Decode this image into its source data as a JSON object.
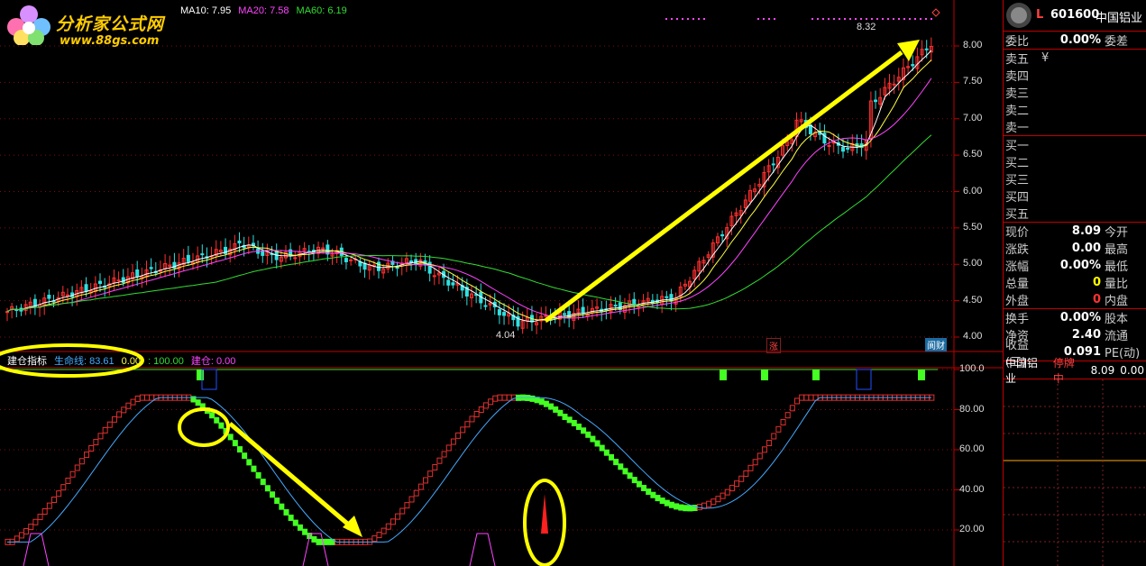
{
  "logo": {
    "name": "分析家公式网",
    "url": "www.88gs.com"
  },
  "ma_legend": [
    {
      "label": "MA10: 7.95",
      "color": "#ffffff"
    },
    {
      "label": "MA20: 7.58",
      "color": "#ff44ff"
    },
    {
      "label": "MA60: 6.19",
      "color": "#33dd33"
    }
  ],
  "indicator_legend": [
    {
      "label": "建仓指标",
      "color": "#ffffff"
    },
    {
      "label": "生命线: 83.61",
      "color": "#44aaff"
    },
    {
      "label": "0.00",
      "color": "#ffff44"
    },
    {
      "label": ": 100.00",
      "color": "#33dd33"
    },
    {
      "label": "建仓: 0.00",
      "color": "#ff44ff"
    }
  ],
  "price_axis": [
    "8.00",
    "7.50",
    "7.00",
    "6.50",
    "6.00",
    "5.50",
    "5.00",
    "4.50",
    "4.00"
  ],
  "indicator_axis": [
    "100.0",
    "80.00",
    "60.00",
    "40.00",
    "20.00"
  ],
  "price_annotations": {
    "high": "8.32",
    "low": "4.04"
  },
  "markers": {
    "zhang": "涨",
    "caizhi": "阆财"
  },
  "stock": {
    "code": "601600",
    "name": "中国铝业",
    "prefix": "L"
  },
  "quote_top": {
    "label": "委比",
    "value": "0.00%",
    "right": "委差"
  },
  "sell_levels": [
    "卖五",
    "卖四",
    "卖三",
    "卖二",
    "卖一"
  ],
  "sell_extra": "¥",
  "buy_levels": [
    "买一",
    "买二",
    "买三",
    "买四",
    "买五"
  ],
  "stats1": [
    {
      "label": "现价",
      "value": "8.09",
      "right": "今开",
      "color": "#ffffff"
    },
    {
      "label": "涨跌",
      "value": "0.00",
      "right": "最高",
      "color": "#ffffff"
    },
    {
      "label": "涨幅",
      "value": "0.00%",
      "right": "最低",
      "color": "#ffffff"
    },
    {
      "label": "总量",
      "value": "0",
      "right": "量比",
      "color": "#ffff00"
    },
    {
      "label": "外盘",
      "value": "0",
      "right": "内盘",
      "color": "#ff3333"
    }
  ],
  "stats2": [
    {
      "label": "换手",
      "value": "0.00%",
      "right": "股本",
      "color": "#ffffff"
    },
    {
      "label": "净资",
      "value": "2.40",
      "right": "流通",
      "color": "#ffffff"
    },
    {
      "label": "收益(三)",
      "value": "0.091",
      "right": "PE(动)",
      "color": "#ffffff"
    }
  ],
  "ticker": {
    "name": "中国铝业",
    "status": "停牌中",
    "price": "8.09",
    "extra": "0.00"
  }
}
